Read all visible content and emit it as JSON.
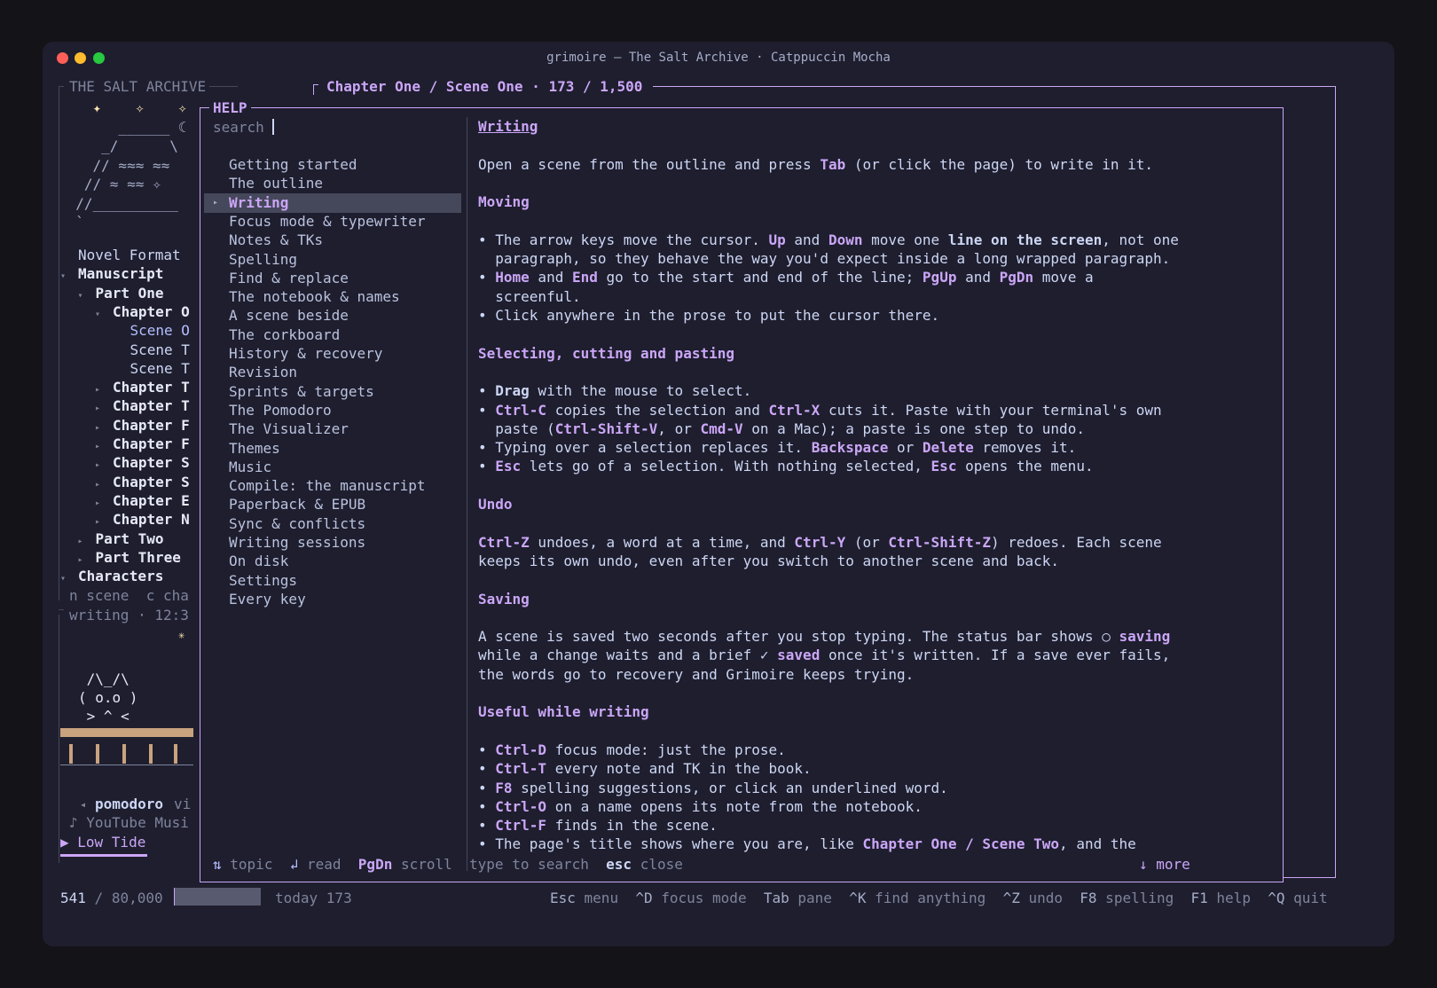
{
  "window": {
    "title": "grimoire — The Salt Archive · Catppuccin Mocha",
    "dot_colors": [
      "#ff5f57",
      "#febc2e",
      "#28c840"
    ]
  },
  "sidebar": {
    "project_title": "THE SALT ARCHIVE",
    "art_lines": [
      "    ✦    ✧    ✧",
      "       ______ ☾",
      "     _/      \\",
      "    // ≈≈≈ ≈≈",
      "   // ≈ ≈≈ ✧",
      "  //__________",
      "  `"
    ],
    "tree": [
      {
        "indent": 0,
        "tri": "",
        "label": "Novel Format",
        "bold": false,
        "active": false
      },
      {
        "indent": 0,
        "tri": "▾",
        "label": "Manuscript",
        "bold": true,
        "active": false
      },
      {
        "indent": 1,
        "tri": "▾",
        "label": "Part One",
        "bold": true,
        "active": false
      },
      {
        "indent": 2,
        "tri": "▾",
        "label": "Chapter O",
        "bold": true,
        "active": false
      },
      {
        "indent": 3,
        "tri": "",
        "label": "Scene O",
        "bold": false,
        "active": true
      },
      {
        "indent": 3,
        "tri": "",
        "label": "Scene T",
        "bold": false,
        "active": false
      },
      {
        "indent": 3,
        "tri": "",
        "label": "Scene T",
        "bold": false,
        "active": false
      },
      {
        "indent": 2,
        "tri": "▸",
        "label": "Chapter T",
        "bold": true,
        "active": false
      },
      {
        "indent": 2,
        "tri": "▸",
        "label": "Chapter T",
        "bold": true,
        "active": false
      },
      {
        "indent": 2,
        "tri": "▸",
        "label": "Chapter F",
        "bold": true,
        "active": false
      },
      {
        "indent": 2,
        "tri": "▸",
        "label": "Chapter F",
        "bold": true,
        "active": false
      },
      {
        "indent": 2,
        "tri": "▸",
        "label": "Chapter S",
        "bold": true,
        "active": false
      },
      {
        "indent": 2,
        "tri": "▸",
        "label": "Chapter S",
        "bold": true,
        "active": false
      },
      {
        "indent": 2,
        "tri": "▸",
        "label": "Chapter E",
        "bold": true,
        "active": false
      },
      {
        "indent": 2,
        "tri": "▸",
        "label": "Chapter N",
        "bold": true,
        "active": false
      },
      {
        "indent": 1,
        "tri": "▸",
        "label": "Part Two",
        "bold": true,
        "active": false
      },
      {
        "indent": 1,
        "tri": "▸",
        "label": "Part Three",
        "bold": true,
        "active": false
      },
      {
        "indent": 0,
        "tri": "▾",
        "label": "Characters",
        "bold": true,
        "active": false
      }
    ],
    "hint": "n scene  c cha",
    "writing_status": "writing · 12:3",
    "sparkle": "✳",
    "cat_lines": [
      " /\\_/\\",
      "( o.o )",
      " > ^ <"
    ],
    "player": {
      "prev_label": "◂",
      "mode": "pomodoro",
      "mode_rest": "vi",
      "source": "♪ YouTube Musi",
      "track": "▶ Low Tide"
    }
  },
  "editor": {
    "breadcrumb": "Chapter One / Scene One · 173 / 1,500"
  },
  "help": {
    "title": "HELP",
    "search_placeholder": "search",
    "topics": [
      "Getting started",
      "The outline",
      "Writing",
      "Focus mode & typewriter",
      "Notes & TKs",
      "Spelling",
      "Find & replace",
      "The notebook & names",
      "A scene beside",
      "The corkboard",
      "History & recovery",
      "Revision",
      "Sprints & targets",
      "The Pomodoro",
      "The Visualizer",
      "Themes",
      "Music",
      "Compile: the manuscript",
      "Paperback & EPUB",
      "Sync & conflicts",
      "Writing sessions",
      "On disk",
      "Settings",
      "Every key"
    ],
    "selected_index": 2,
    "selected_marker": "▸",
    "content_lines": [
      [
        {
          "t": "Writing",
          "s": "title"
        }
      ],
      [],
      [
        {
          "t": "Open a scene from the outline and press "
        },
        {
          "t": "Tab",
          "s": "k"
        },
        {
          "t": " (or click the page) to write in it."
        }
      ],
      [],
      [
        {
          "t": "Moving",
          "s": "h"
        }
      ],
      [],
      [
        {
          "t": "• The arrow keys move the cursor. "
        },
        {
          "t": "Up",
          "s": "k"
        },
        {
          "t": " and "
        },
        {
          "t": "Down",
          "s": "k"
        },
        {
          "t": " move one "
        },
        {
          "t": "line on the screen",
          "s": "b"
        },
        {
          "t": ", not one"
        }
      ],
      [
        {
          "t": "  paragraph, so they behave the way you'd expect inside a long wrapped paragraph."
        }
      ],
      [
        {
          "t": "• "
        },
        {
          "t": "Home",
          "s": "k"
        },
        {
          "t": " and "
        },
        {
          "t": "End",
          "s": "k"
        },
        {
          "t": " go to the start and end of the line; "
        },
        {
          "t": "PgUp",
          "s": "k"
        },
        {
          "t": " and "
        },
        {
          "t": "PgDn",
          "s": "k"
        },
        {
          "t": " move a"
        }
      ],
      [
        {
          "t": "  screenful."
        }
      ],
      [
        {
          "t": "• Click anywhere in the prose to put the cursor there."
        }
      ],
      [],
      [
        {
          "t": "Selecting, cutting and pasting",
          "s": "h"
        }
      ],
      [],
      [
        {
          "t": "• "
        },
        {
          "t": "Drag",
          "s": "b"
        },
        {
          "t": " with the mouse to select."
        }
      ],
      [
        {
          "t": "• "
        },
        {
          "t": "Ctrl-C",
          "s": "k"
        },
        {
          "t": " copies the selection and "
        },
        {
          "t": "Ctrl-X",
          "s": "k"
        },
        {
          "t": " cuts it. Paste with your terminal's own"
        }
      ],
      [
        {
          "t": "  paste ("
        },
        {
          "t": "Ctrl-Shift-V",
          "s": "k"
        },
        {
          "t": ", or "
        },
        {
          "t": "Cmd-V",
          "s": "k"
        },
        {
          "t": " on a Mac); a paste is one step to undo."
        }
      ],
      [
        {
          "t": "• Typing over a selection replaces it. "
        },
        {
          "t": "Backspace",
          "s": "k"
        },
        {
          "t": " or "
        },
        {
          "t": "Delete",
          "s": "k"
        },
        {
          "t": " removes it."
        }
      ],
      [
        {
          "t": "• "
        },
        {
          "t": "Esc",
          "s": "k"
        },
        {
          "t": " lets go of a selection. With nothing selected, "
        },
        {
          "t": "Esc",
          "s": "k"
        },
        {
          "t": " opens the menu."
        }
      ],
      [],
      [
        {
          "t": "Undo",
          "s": "h"
        }
      ],
      [],
      [
        {
          "t": "Ctrl-Z",
          "s": "k"
        },
        {
          "t": " undoes, a word at a time, and "
        },
        {
          "t": "Ctrl-Y",
          "s": "k"
        },
        {
          "t": " (or "
        },
        {
          "t": "Ctrl-Shift-Z",
          "s": "k"
        },
        {
          "t": ") redoes. Each scene"
        }
      ],
      [
        {
          "t": "keeps its own undo, even after you switch to another scene and back."
        }
      ],
      [],
      [
        {
          "t": "Saving",
          "s": "h"
        }
      ],
      [],
      [
        {
          "t": "A scene is saved two seconds after you stop typing. The status bar shows ○ "
        },
        {
          "t": "saving",
          "s": "k"
        }
      ],
      [
        {
          "t": "while a change waits and a brief ✓ "
        },
        {
          "t": "saved",
          "s": "k"
        },
        {
          "t": " once it's written. If a save ever fails,"
        }
      ],
      [
        {
          "t": "the words go to recovery and Grimoire keeps trying."
        }
      ],
      [],
      [
        {
          "t": "Useful while writing",
          "s": "h"
        }
      ],
      [],
      [
        {
          "t": "• "
        },
        {
          "t": "Ctrl-D",
          "s": "k"
        },
        {
          "t": " focus mode: just the prose."
        }
      ],
      [
        {
          "t": "• "
        },
        {
          "t": "Ctrl-T",
          "s": "k"
        },
        {
          "t": " every note and TK in the book."
        }
      ],
      [
        {
          "t": "• "
        },
        {
          "t": "F8",
          "s": "k"
        },
        {
          "t": " spelling suggestions, or click an underlined word."
        }
      ],
      [
        {
          "t": "• "
        },
        {
          "t": "Ctrl-O",
          "s": "k"
        },
        {
          "t": " on a name opens its note from the notebook."
        }
      ],
      [
        {
          "t": "• "
        },
        {
          "t": "Ctrl-F",
          "s": "k"
        },
        {
          "t": " finds in the scene."
        }
      ],
      [
        {
          "t": "• The page's title shows where you are, like "
        },
        {
          "t": "Chapter One / Scene Two",
          "s": "k"
        },
        {
          "t": ", and the"
        }
      ]
    ],
    "footer": {
      "arrows": "⇅",
      "topic": "topic",
      "enter": "↲",
      "read": "read",
      "pgdn": "PgDn",
      "scroll": "scroll",
      "type_to_search": "type to search",
      "esc": "esc",
      "close": "close",
      "more": "↓ more"
    }
  },
  "status_bar": {
    "words": "541",
    "goal": "/ 80,000",
    "progress": 0.00676,
    "today": "today 173",
    "shortcuts": [
      {
        "key": "Esc",
        "label": "menu"
      },
      {
        "key": "^D",
        "label": "focus mode"
      },
      {
        "key": "Tab",
        "label": "pane"
      },
      {
        "key": "^K",
        "label": "find anything"
      },
      {
        "key": "^Z",
        "label": "undo"
      },
      {
        "key": "F8",
        "label": "spelling"
      },
      {
        "key": "F1",
        "label": "help"
      },
      {
        "key": "^Q",
        "label": "quit"
      }
    ]
  },
  "colors": {
    "bg": "#1e1e2e",
    "accent": "#cba6f7",
    "text": "#cdd6f4",
    "muted": "#7f849c",
    "selection": "#45475a",
    "widget_wood": "#c9a27e"
  }
}
